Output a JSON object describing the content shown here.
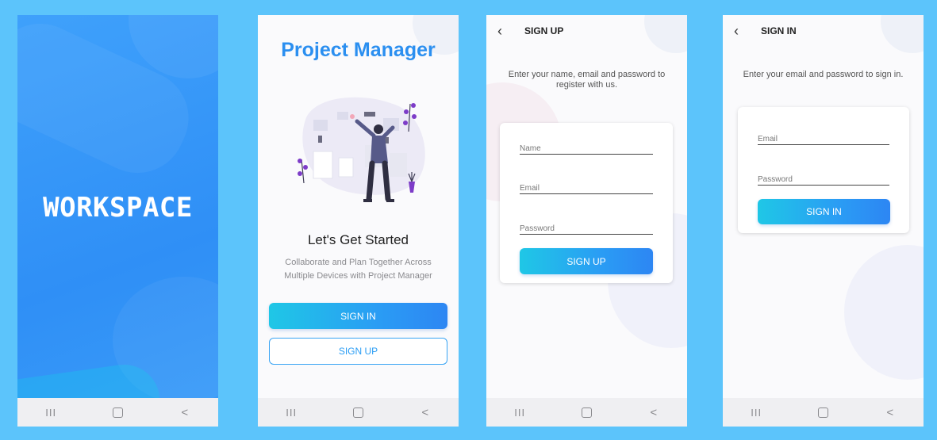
{
  "splash": {
    "title": "WORKSPACE"
  },
  "onboarding": {
    "app_title": "Project Manager",
    "heading": "Let's Get Started",
    "description": "Collaborate and Plan Together Across Multiple Devices with Project Manager",
    "signin_label": "SIGN IN",
    "signup_label": "SIGN UP"
  },
  "signup": {
    "title": "SIGN UP",
    "instruction": "Enter your name, email and password to register with us.",
    "name_placeholder": "Name",
    "email_placeholder": "Email",
    "password_placeholder": "Password",
    "submit_label": "SIGN UP"
  },
  "signin": {
    "title": "SIGN IN",
    "instruction": "Enter your email and password to sign in.",
    "email_placeholder": "Email",
    "password_placeholder": "Password",
    "submit_label": "SIGN IN"
  },
  "navbar": {
    "recents_icon": "III",
    "home_icon": "home-icon",
    "back_icon": "<"
  },
  "colors": {
    "background": "#5cc4fb",
    "accent": "#2a9df4",
    "gradient_start": "#1fc7e6",
    "gradient_end": "#2d86f3"
  }
}
